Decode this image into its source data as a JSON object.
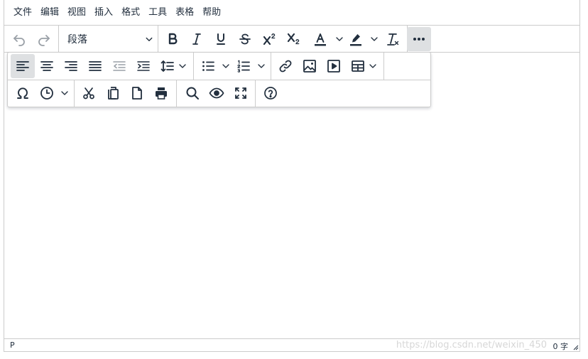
{
  "menubar": {
    "items": [
      "文件",
      "编辑",
      "视图",
      "插入",
      "格式",
      "工具",
      "表格",
      "帮助"
    ]
  },
  "toolbar": {
    "block_format": "段落",
    "icons": [
      "undo-icon",
      "redo-icon",
      "bold-icon",
      "italic-icon",
      "underline-icon",
      "strikethrough-icon",
      "superscript-icon",
      "subscript-icon",
      "text-color-icon",
      "highlight-color-icon",
      "remove-format-icon",
      "more-icon"
    ]
  },
  "overflow_toolbar": {
    "row1_icons": [
      "align-left-icon",
      "align-center-icon",
      "align-right-icon",
      "align-justify-icon",
      "outdent-icon",
      "indent-icon",
      "line-height-icon",
      "bullet-list-icon",
      "numbered-list-icon",
      "link-icon",
      "image-icon",
      "media-icon",
      "table-icon"
    ],
    "row2_icons": [
      "special-char-icon",
      "datetime-icon",
      "cut-icon",
      "copy-icon",
      "new-document-icon",
      "print-icon",
      "search-replace-icon",
      "preview-icon",
      "fullscreen-icon",
      "help-icon"
    ]
  },
  "statusbar": {
    "path": "P",
    "word_count": "0 字",
    "watermark": "https://blog.csdn.net/weixin_450"
  },
  "colors": {
    "border": "#cccccc",
    "text": "#222f3e",
    "active_bg": "#dee0e2"
  }
}
